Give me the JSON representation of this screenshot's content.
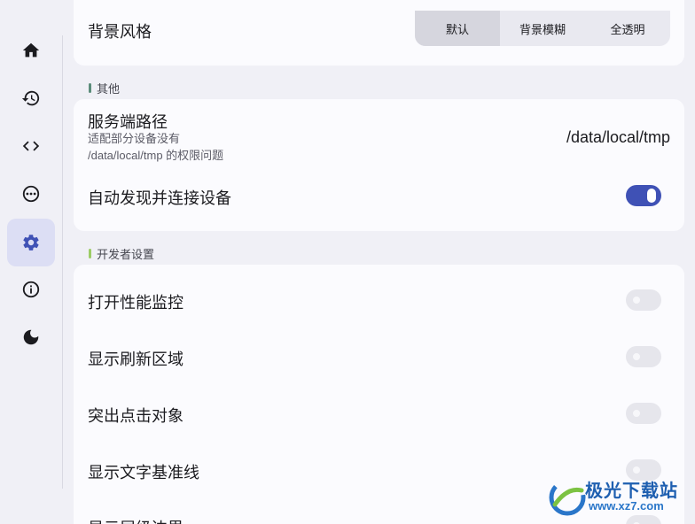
{
  "window": {
    "controls": [
      "minimize-icon",
      "maximize-icon",
      "close-icon"
    ]
  },
  "sidebar": {
    "items": [
      {
        "icon": "home-icon",
        "active": false
      },
      {
        "icon": "history-icon",
        "active": false
      },
      {
        "icon": "code-icon",
        "active": false
      },
      {
        "icon": "more-icon",
        "active": false
      },
      {
        "icon": "gear-icon",
        "active": true
      },
      {
        "icon": "info-icon",
        "active": false
      },
      {
        "icon": "moon-icon",
        "active": false
      }
    ]
  },
  "background_style": {
    "title": "背景风格",
    "options": [
      "默认",
      "背景模糊",
      "全透明"
    ],
    "selected": "默认"
  },
  "other_section": {
    "label": "其他",
    "server_path": {
      "title": "服务端路径",
      "subtitle_line1": "适配部分设备没有",
      "subtitle_line2": "/data/local/tmp 的权限问题",
      "value": "/data/local/tmp"
    },
    "auto_connect": {
      "title": "自动发现并连接设备",
      "enabled": true
    }
  },
  "developer_section": {
    "label": "开发者设置",
    "items": [
      {
        "title": "打开性能监控",
        "enabled": false
      },
      {
        "title": "显示刷新区域",
        "enabled": false
      },
      {
        "title": "突出点击对象",
        "enabled": false
      },
      {
        "title": "显示文字基准线",
        "enabled": false
      },
      {
        "title": "显示层级边界",
        "enabled": false
      }
    ]
  },
  "colors": {
    "accent": "#3f51b5",
    "section_bar_other": "#5b8c7a",
    "section_bar_dev": "#9ccc65"
  },
  "watermark": {
    "text": "极光下载站",
    "url": "www.xz7.com"
  }
}
